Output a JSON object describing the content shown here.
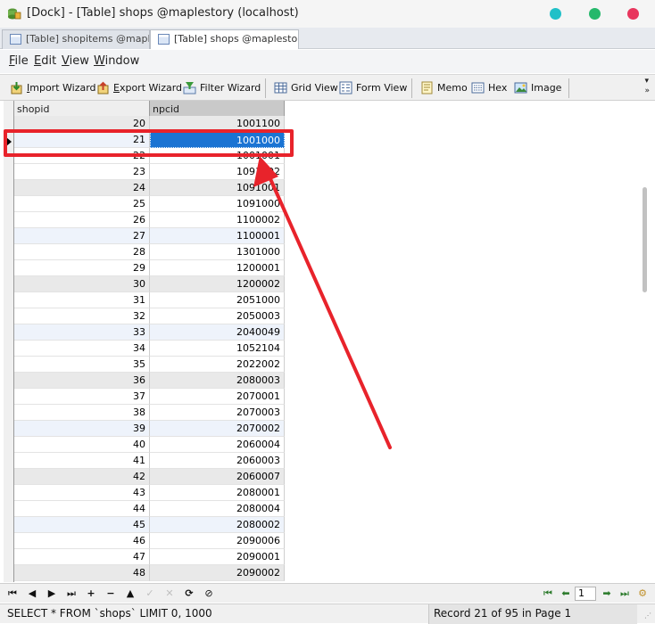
{
  "window": {
    "title": "[Dock] - [Table] shops @maplestory (localhost)",
    "controls": {
      "minimize_color": "#20c0c8",
      "maximize_color": "#25b86b",
      "close_color": "#e8365d"
    }
  },
  "tabs": [
    {
      "label": "[Table] shopitems @mapl...",
      "active": false
    },
    {
      "label": "[Table] shops @maplesto...",
      "active": true
    }
  ],
  "menu": [
    {
      "label": "File",
      "mnemonic": "F",
      "rest": "ile"
    },
    {
      "label": "Edit",
      "mnemonic": "E",
      "rest": "dit"
    },
    {
      "label": "View",
      "mnemonic": "V",
      "rest": "iew"
    },
    {
      "label": "Window",
      "mnemonic": "W",
      "rest": "indow"
    }
  ],
  "toolbar": {
    "import_wizard": {
      "mnemonic": "I",
      "rest": "mport Wizard",
      "icon": "import-icon"
    },
    "export_wizard": {
      "mnemonic": "E",
      "rest": "xport Wizard",
      "icon": "export-icon"
    },
    "filter_wizard": {
      "label": "Filter Wizard",
      "icon": "filter-icon"
    },
    "grid_view": {
      "label": "Grid View",
      "icon": "grid-view-icon"
    },
    "form_view": {
      "label": "Form View",
      "icon": "form-view-icon"
    },
    "memo": {
      "label": "Memo",
      "icon": "memo-icon"
    },
    "hex": {
      "label": "Hex",
      "icon": "hex-icon"
    },
    "image": {
      "label": "Image",
      "icon": "image-icon"
    },
    "overflow": "»"
  },
  "table": {
    "columns": [
      "shopid",
      "npcid"
    ],
    "selected_column": "npcid",
    "selected_row_shopid": "21",
    "rows": [
      {
        "shopid": "20",
        "npcid": "1001100",
        "shade": "gray"
      },
      {
        "shopid": "21",
        "npcid": "1001000",
        "shade": "blue",
        "selected": true
      },
      {
        "shopid": "22",
        "npcid": "1001001",
        "shade": "none"
      },
      {
        "shopid": "23",
        "npcid": "1091002",
        "shade": "none"
      },
      {
        "shopid": "24",
        "npcid": "1091001",
        "shade": "gray"
      },
      {
        "shopid": "25",
        "npcid": "1091000",
        "shade": "none"
      },
      {
        "shopid": "26",
        "npcid": "1100002",
        "shade": "none"
      },
      {
        "shopid": "27",
        "npcid": "1100001",
        "shade": "blue"
      },
      {
        "shopid": "28",
        "npcid": "1301000",
        "shade": "none"
      },
      {
        "shopid": "29",
        "npcid": "1200001",
        "shade": "none"
      },
      {
        "shopid": "30",
        "npcid": "1200002",
        "shade": "gray"
      },
      {
        "shopid": "31",
        "npcid": "2051000",
        "shade": "none"
      },
      {
        "shopid": "32",
        "npcid": "2050003",
        "shade": "none"
      },
      {
        "shopid": "33",
        "npcid": "2040049",
        "shade": "blue"
      },
      {
        "shopid": "34",
        "npcid": "1052104",
        "shade": "none"
      },
      {
        "shopid": "35",
        "npcid": "2022002",
        "shade": "none"
      },
      {
        "shopid": "36",
        "npcid": "2080003",
        "shade": "gray"
      },
      {
        "shopid": "37",
        "npcid": "2070001",
        "shade": "none"
      },
      {
        "shopid": "38",
        "npcid": "2070003",
        "shade": "none"
      },
      {
        "shopid": "39",
        "npcid": "2070002",
        "shade": "blue"
      },
      {
        "shopid": "40",
        "npcid": "2060004",
        "shade": "none"
      },
      {
        "shopid": "41",
        "npcid": "2060003",
        "shade": "none"
      },
      {
        "shopid": "42",
        "npcid": "2060007",
        "shade": "gray"
      },
      {
        "shopid": "43",
        "npcid": "2080001",
        "shade": "none"
      },
      {
        "shopid": "44",
        "npcid": "2080004",
        "shade": "none"
      },
      {
        "shopid": "45",
        "npcid": "2080002",
        "shade": "blue"
      },
      {
        "shopid": "46",
        "npcid": "2090006",
        "shade": "none"
      },
      {
        "shopid": "47",
        "npcid": "2090001",
        "shade": "none"
      },
      {
        "shopid": "48",
        "npcid": "2090002",
        "shade": "gray"
      }
    ]
  },
  "annotation": {
    "color": "#e8232b"
  },
  "navigation": {
    "first": "⏮",
    "prev": "◀",
    "next": "▶",
    "last": "⏭",
    "add": "+",
    "delete": "−",
    "up": "▲",
    "apply": "✓",
    "cancel": "✕",
    "refresh": "⟳",
    "stop": "⊘",
    "page_value": "1"
  },
  "status": {
    "sql": "SELECT * FROM `shops` LIMIT 0, 1000",
    "record": "Record 21 of 95 in Page 1"
  }
}
